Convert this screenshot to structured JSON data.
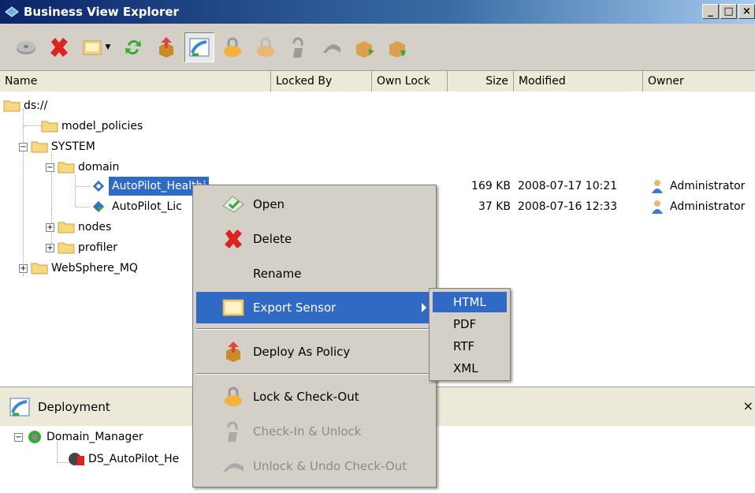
{
  "window": {
    "title": "Business View Explorer",
    "buttons": [
      "_",
      "□",
      "×"
    ]
  },
  "toolbar": {
    "buttons": [
      {
        "name": "disk-icon"
      },
      {
        "name": "delete-icon"
      },
      {
        "name": "export-folder-icon"
      },
      {
        "name": "refresh-icon"
      },
      {
        "name": "deploy-icon"
      },
      {
        "name": "deployment-view-icon"
      },
      {
        "name": "lock-icon"
      },
      {
        "name": "lock-checkout-icon"
      },
      {
        "name": "checkin-unlock-icon"
      },
      {
        "name": "undo-checkout-icon"
      },
      {
        "name": "import-icon"
      },
      {
        "name": "export-icon"
      }
    ]
  },
  "columns": [
    "Name",
    "Locked By",
    "Own Lock",
    "Size",
    "Modified",
    "Owner"
  ],
  "tree": {
    "root": "ds://",
    "model_policies": "model_policies",
    "system": "SYSTEM",
    "domain": "domain",
    "item1": "AutoPilot_Healthi",
    "item2": "AutoPilot_Lic",
    "nodes": "nodes",
    "profiler": "profiler",
    "websphere": "WebSphere_MQ"
  },
  "details": [
    {
      "size": "169 KB",
      "modified": "2008-07-17 10:21",
      "owner": "Administrator"
    },
    {
      "size": "37 KB",
      "modified": "2008-07-16 12:33",
      "owner": "Administrator"
    }
  ],
  "deployment": {
    "title": "Deployment",
    "close": "×",
    "manager": "Domain_Manager",
    "item": "DS_AutoPilot_He"
  },
  "context_menu": {
    "open": "Open",
    "delete": "Delete",
    "rename": "Rename",
    "export": "Export Sensor",
    "deploy": "Deploy As Policy",
    "lock": "Lock & Check-Out",
    "checkin": "Check-In & Unlock",
    "unlock": "Unlock & Undo Check-Out"
  },
  "submenu": [
    "HTML",
    "PDF",
    "RTF",
    "XML"
  ],
  "colors": {
    "selection": "#316ac5",
    "title_start": "#0a246a",
    "chrome": "#d4d0c8"
  }
}
